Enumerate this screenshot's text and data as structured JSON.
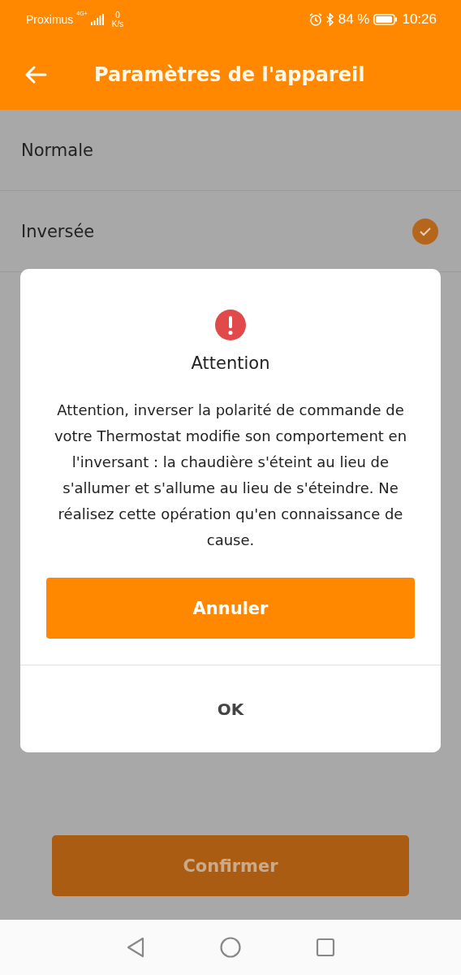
{
  "status_bar": {
    "carrier": "Proximus",
    "network": "4G+",
    "speed_value": "0",
    "speed_unit": "K/s",
    "battery": "84 %",
    "time": "10:26"
  },
  "app_bar": {
    "title": "Paramètres de l'appareil"
  },
  "options": [
    {
      "label": "Normale",
      "selected": false
    },
    {
      "label": "Inversée",
      "selected": true
    }
  ],
  "dialog": {
    "title": "Attention",
    "message": "Attention, inverser la polarité de commande de votre Thermostat modifie son comportement en l'inversant : la chaudière s'éteint au lieu de s'allumer et s'allume au lieu de s'éteindre. Ne réalisez cette opération qu'en connaissance de cause.",
    "buttons": [
      {
        "label": "Annuler",
        "kind": "primary"
      },
      {
        "label": "OK",
        "kind": "text"
      }
    ]
  },
  "confirm_button": {
    "label": "Confirmer"
  }
}
